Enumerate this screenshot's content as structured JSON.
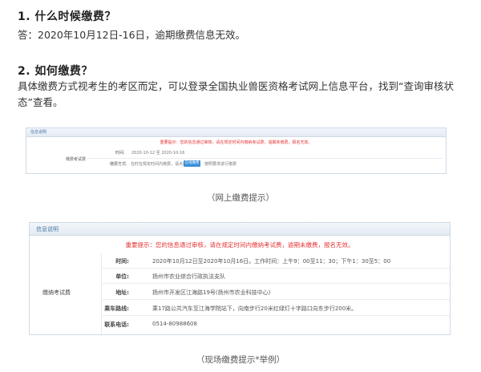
{
  "section1": {
    "title": "1. 什么时候缴费？",
    "body": "答：2020年10月12日-16日，逾期缴费信息无效。"
  },
  "section2": {
    "title": "2. 如何缴费？",
    "body": "具体缴费方式视考生的考区而定，可以登录全国执业兽医资格考试网上信息平台，找到“查询审核状态”查看。"
  },
  "online_shot": {
    "header": "信息说明",
    "warning": "重要提示：您的信息通过审核，请在规定时间内缴纳考试费，逾期未缴费，报名无效。",
    "row_label": "缴费考试费",
    "time_key": "时间:",
    "time_value": "2020-10-12 至 2020-10-16",
    "method_key": "缴费方式:",
    "method_value": "在时在规定时间内缴费，请点击",
    "button_label": "在线缴费",
    "after_button": "按照要求进行缴费"
  },
  "caption1": "（网上缴费提示）",
  "onsite_shot": {
    "header": "信息说明",
    "warning": "重要提示：您的信息通过审核，请在规定时间内缴纳考试费，逾期未缴费，报名无效。",
    "left_label": "缴纳考试费",
    "rows": [
      {
        "key": "时间:",
        "value": "2020年10月12日至2020年10月16日。工作时间：上午9：00至11：30；下午1：30至5：00"
      },
      {
        "key": "单位:",
        "value": "扬州市农业综合行政执法支队"
      },
      {
        "key": "地址:",
        "value": "扬州市开发区江海路19号(扬州市农业科技中心)"
      },
      {
        "key": "乘车路线:",
        "value": "乘17路公共汽车至江海学院站下，向南步行20米红绿灯十字路口向东步行200米。"
      },
      {
        "key": "联系电话:",
        "value": "0514-80988608"
      }
    ]
  },
  "caption2": "（现场缴费提示*举例）"
}
